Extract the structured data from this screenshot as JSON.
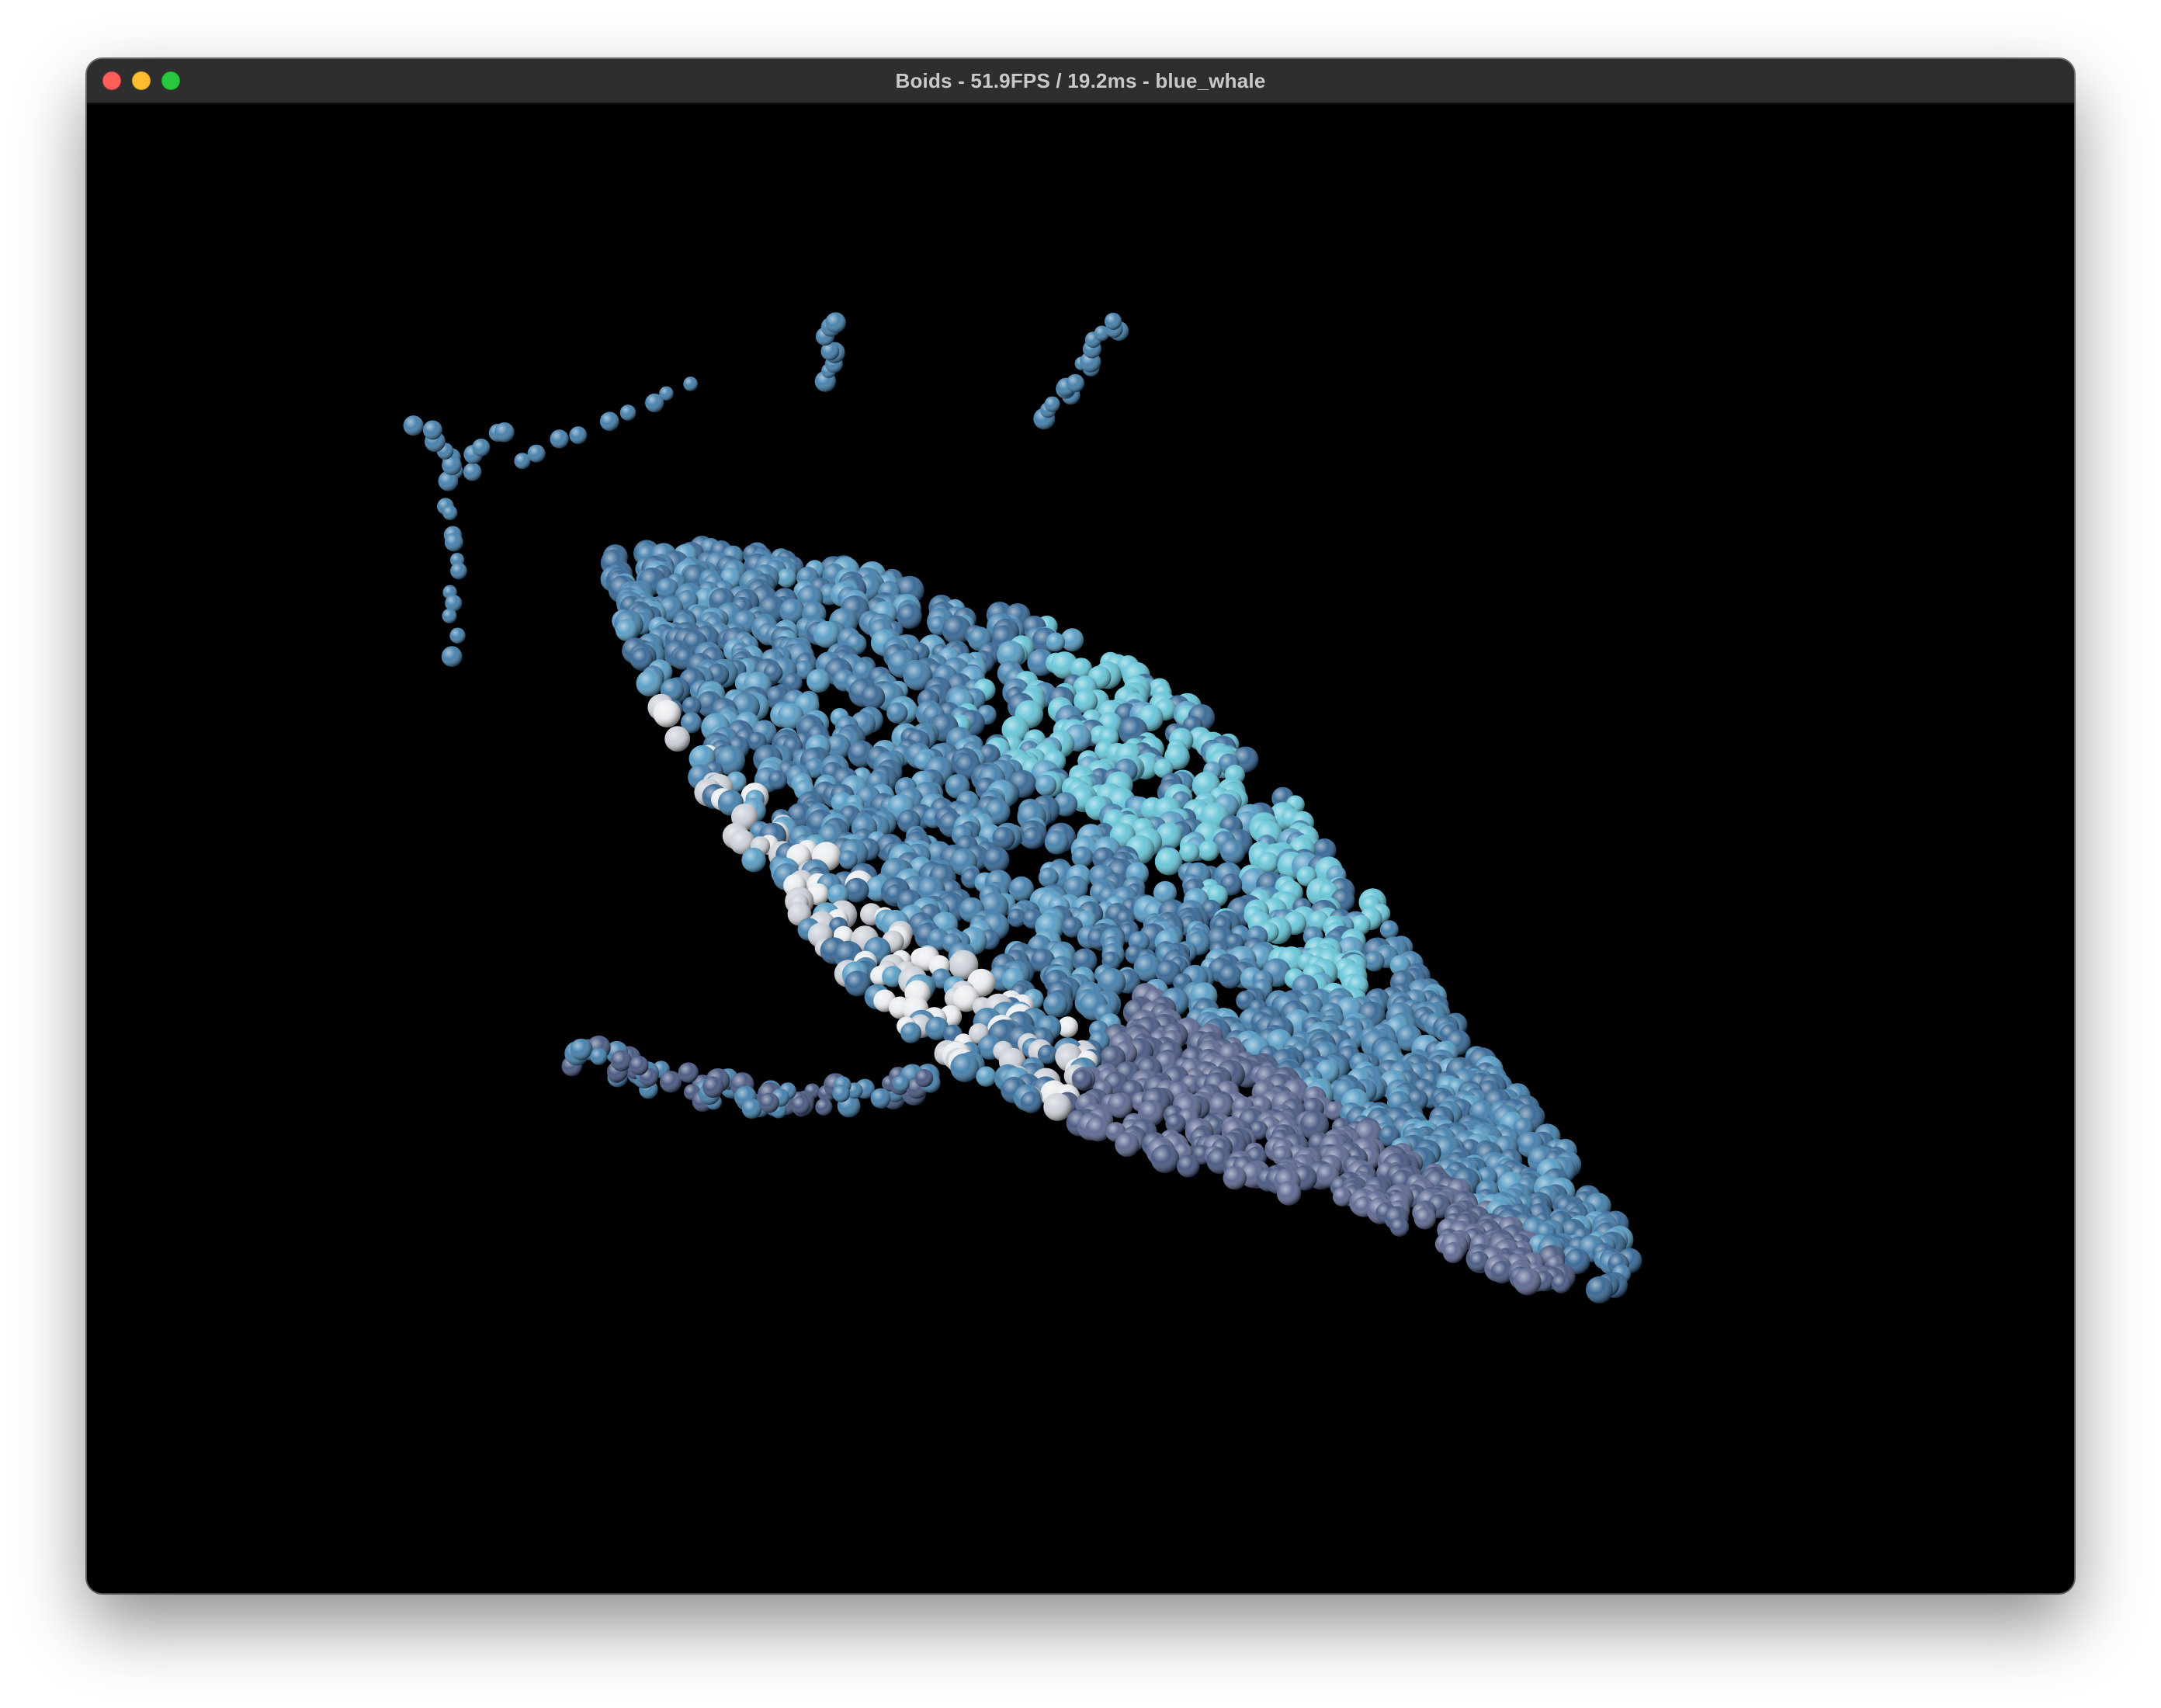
{
  "window": {
    "title": "Boids - 51.9FPS / 19.2ms - blue_whale"
  },
  "traffic_lights": {
    "close_color": "#ff5f57",
    "minimize_color": "#febc2e",
    "zoom_color": "#28c840"
  },
  "scene": {
    "background": "#000000",
    "palette": [
      "#2b5f8f",
      "#3a79a8",
      "#4f98c2",
      "#5fc2d6",
      "#3d4f7a",
      "#55618c",
      "#c9ced6",
      "#e9ecef"
    ]
  }
}
